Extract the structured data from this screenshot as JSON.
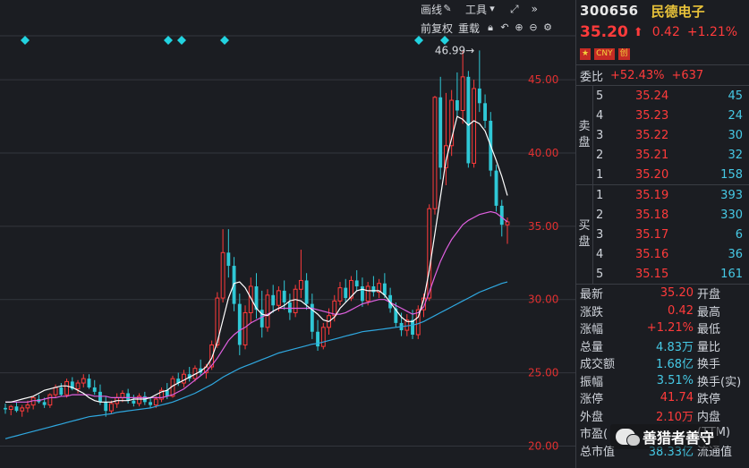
{
  "toolbar": {
    "draw_label": "画线",
    "tools_label": "工具",
    "adjust_label": "前复权",
    "reload_label": "重载"
  },
  "stock": {
    "code": "300656",
    "name": "民德电子",
    "price": "35.20",
    "change": "0.42",
    "change_pct": "+1.21%",
    "badges": [
      "CNY",
      "创"
    ]
  },
  "weibi": {
    "label": "委比",
    "pct": "+52.43%",
    "diff": "+637"
  },
  "ask": {
    "label": "卖盘",
    "rows": [
      {
        "level": "5",
        "price": "35.24",
        "vol": "45"
      },
      {
        "level": "4",
        "price": "35.23",
        "vol": "24"
      },
      {
        "level": "3",
        "price": "35.22",
        "vol": "30"
      },
      {
        "level": "2",
        "price": "35.21",
        "vol": "32"
      },
      {
        "level": "1",
        "price": "35.20",
        "vol": "158"
      }
    ]
  },
  "bid": {
    "label": "买盘",
    "rows": [
      {
        "level": "1",
        "price": "35.19",
        "vol": "393"
      },
      {
        "level": "2",
        "price": "35.18",
        "vol": "330"
      },
      {
        "level": "3",
        "price": "35.17",
        "vol": "6"
      },
      {
        "level": "4",
        "price": "35.16",
        "vol": "36"
      },
      {
        "level": "5",
        "price": "35.15",
        "vol": "161"
      }
    ]
  },
  "stats": [
    {
      "k": "最新",
      "v": "35.20",
      "k2": "开盘"
    },
    {
      "k": "涨跌",
      "v": "0.42",
      "k2": "最高"
    },
    {
      "k": "涨幅",
      "v": "+1.21%",
      "k2": "最低"
    },
    {
      "k": "总量",
      "v": "4.83万",
      "k2": "量比"
    },
    {
      "k": "成交额",
      "v": "1.68亿",
      "k2": "换手"
    },
    {
      "k": "振幅",
      "v": "3.51%",
      "k2": "换手(实)"
    },
    {
      "k": "涨停",
      "v": "41.74",
      "k2": "跌停"
    },
    {
      "k": "外盘",
      "v": "2.10万",
      "k2": "内盘"
    },
    {
      "k": "市盈(",
      "v": "",
      "k2": "(TTM)"
    },
    {
      "k": "总市值",
      "v": "38.33亿",
      "k2": "流通值"
    }
  ],
  "colors": {
    "up": "#ff3b3b",
    "down": "#2fc8d6",
    "ma5": "#ffffff",
    "ma10": "#e060e0",
    "ma20": "#2fa8e0",
    "grid": "#33363d",
    "axis_text": "#e03030"
  },
  "watermark": "善猎者善守",
  "chart_data": {
    "type": "candlestick",
    "ylim": [
      18.5,
      48
    ],
    "y_ticks": [
      20.0,
      25.0,
      30.0,
      35.0,
      40.0,
      45.0
    ],
    "y_tick_labels": [
      "20.00",
      "25.00",
      "30.00",
      "35.00",
      "40.00",
      "45.00"
    ],
    "max_label": "46.99→",
    "grid": true,
    "candles": [
      [
        22.6,
        22.9,
        22.2,
        22.5
      ],
      [
        22.5,
        22.8,
        22.1,
        22.7
      ],
      [
        22.7,
        23.0,
        22.3,
        22.4
      ],
      [
        22.4,
        22.8,
        22.0,
        22.6
      ],
      [
        22.6,
        23.1,
        22.3,
        22.8
      ],
      [
        22.8,
        23.4,
        22.5,
        23.3
      ],
      [
        23.2,
        23.5,
        22.9,
        23.0
      ],
      [
        23.0,
        23.3,
        22.6,
        22.8
      ],
      [
        22.8,
        23.6,
        22.6,
        23.5
      ],
      [
        23.5,
        24.2,
        23.3,
        24.0
      ],
      [
        24.0,
        24.3,
        23.4,
        23.5
      ],
      [
        23.5,
        24.6,
        23.3,
        24.4
      ],
      [
        24.4,
        24.7,
        23.8,
        23.9
      ],
      [
        23.9,
        24.5,
        23.6,
        24.3
      ],
      [
        24.3,
        24.9,
        24.0,
        24.6
      ],
      [
        24.6,
        24.9,
        23.9,
        24.0
      ],
      [
        24.0,
        24.5,
        23.5,
        23.7
      ],
      [
        23.7,
        24.2,
        22.8,
        23.0
      ],
      [
        23.0,
        23.4,
        22.0,
        22.4
      ],
      [
        22.4,
        23.1,
        22.2,
        22.9
      ],
      [
        22.9,
        23.6,
        22.6,
        23.3
      ],
      [
        23.3,
        23.8,
        23.0,
        23.6
      ],
      [
        23.6,
        23.9,
        22.9,
        23.1
      ],
      [
        23.1,
        23.5,
        22.7,
        22.9
      ],
      [
        22.9,
        23.6,
        22.7,
        23.4
      ],
      [
        23.4,
        23.7,
        22.8,
        23.0
      ],
      [
        23.0,
        23.3,
        22.6,
        22.8
      ],
      [
        22.8,
        23.4,
        22.6,
        23.2
      ],
      [
        23.2,
        24.0,
        23.0,
        23.8
      ],
      [
        23.8,
        24.3,
        23.2,
        23.4
      ],
      [
        23.4,
        24.8,
        23.3,
        24.6
      ],
      [
        24.6,
        25.0,
        24.1,
        24.3
      ],
      [
        24.3,
        25.2,
        24.0,
        24.9
      ],
      [
        24.9,
        25.4,
        24.4,
        24.6
      ],
      [
        24.6,
        25.5,
        24.4,
        25.3
      ],
      [
        25.3,
        25.9,
        24.8,
        25.0
      ],
      [
        25.0,
        25.6,
        24.6,
        25.4
      ],
      [
        25.4,
        27.2,
        25.2,
        26.9
      ],
      [
        26.9,
        30.5,
        26.7,
        30.1
      ],
      [
        30.1,
        34.8,
        29.8,
        33.2
      ],
      [
        33.2,
        34.8,
        31.5,
        32.3
      ],
      [
        32.3,
        32.9,
        29.2,
        29.7
      ],
      [
        29.7,
        30.4,
        26.2,
        26.9
      ],
      [
        26.9,
        29.6,
        26.6,
        29.1
      ],
      [
        29.1,
        31.5,
        28.4,
        30.9
      ],
      [
        30.9,
        31.8,
        28.7,
        29.3
      ],
      [
        29.3,
        30.6,
        27.4,
        28.1
      ],
      [
        28.1,
        30.7,
        27.8,
        30.3
      ],
      [
        30.3,
        31.0,
        29.1,
        29.6
      ],
      [
        29.6,
        30.9,
        29.2,
        30.6
      ],
      [
        30.6,
        31.3,
        29.3,
        29.8
      ],
      [
        29.8,
        30.4,
        28.6,
        29.1
      ],
      [
        29.1,
        31.0,
        28.8,
        30.7
      ],
      [
        30.7,
        33.4,
        30.1,
        31.3
      ],
      [
        31.3,
        31.8,
        29.3,
        29.7
      ],
      [
        29.7,
        30.4,
        27.3,
        27.8
      ],
      [
        27.8,
        28.6,
        26.5,
        26.8
      ],
      [
        26.8,
        28.4,
        26.6,
        28.1
      ],
      [
        28.1,
        29.4,
        27.6,
        28.9
      ],
      [
        28.9,
        30.3,
        28.5,
        29.9
      ],
      [
        29.9,
        31.2,
        29.6,
        30.8
      ],
      [
        30.8,
        31.4,
        29.8,
        30.1
      ],
      [
        30.1,
        31.6,
        29.9,
        31.3
      ],
      [
        31.3,
        32.0,
        30.6,
        30.9
      ],
      [
        30.9,
        31.5,
        29.5,
        29.9
      ],
      [
        29.9,
        31.2,
        29.6,
        30.9
      ],
      [
        30.9,
        31.6,
        30.2,
        30.5
      ],
      [
        30.5,
        31.4,
        30.1,
        31.1
      ],
      [
        31.1,
        31.8,
        30.1,
        30.3
      ],
      [
        30.3,
        30.8,
        29.1,
        29.4
      ],
      [
        29.4,
        29.8,
        28.1,
        28.4
      ],
      [
        28.4,
        29.1,
        27.5,
        27.9
      ],
      [
        27.9,
        29.0,
        27.5,
        28.6
      ],
      [
        28.6,
        29.3,
        27.3,
        27.6
      ],
      [
        27.6,
        29.6,
        27.3,
        29.3
      ],
      [
        29.3,
        30.4,
        28.8,
        30.1
      ],
      [
        30.1,
        36.5,
        29.9,
        36.2
      ],
      [
        36.2,
        43.9,
        35.8,
        43.8
      ],
      [
        43.8,
        45.2,
        38.2,
        39.0
      ],
      [
        39.0,
        44.1,
        37.8,
        40.5
      ],
      [
        40.5,
        44.3,
        39.8,
        43.6
      ],
      [
        43.6,
        45.5,
        42.5,
        42.9
      ],
      [
        42.9,
        46.99,
        42.0,
        45.2
      ],
      [
        45.2,
        45.6,
        39.0,
        39.3
      ],
      [
        39.3,
        45.0,
        39.0,
        44.4
      ],
      [
        44.4,
        47.0,
        42.8,
        43.4
      ],
      [
        43.4,
        44.0,
        41.7,
        42.2
      ],
      [
        42.2,
        42.8,
        38.4,
        38.8
      ],
      [
        38.8,
        39.2,
        36.0,
        36.4
      ],
      [
        36.4,
        36.8,
        34.3,
        35.1
      ],
      [
        35.1,
        35.6,
        33.8,
        35.3
      ]
    ],
    "ma5": [
      23.0,
      23.0,
      23.1,
      23.2,
      23.3,
      23.4,
      23.6,
      23.8,
      23.9,
      24.0,
      24.1,
      24.1,
      24.0,
      23.8,
      23.6,
      23.3,
      23.1,
      23.0,
      23.0,
      23.0,
      23.1,
      23.1,
      23.1,
      23.2,
      23.2,
      23.2,
      23.3,
      23.5,
      23.7,
      23.8,
      24.1,
      24.3,
      24.5,
      24.7,
      24.9,
      25.1,
      25.4,
      26.0,
      27.1,
      28.6,
      30.1,
      31.1,
      31.2,
      30.8,
      30.1,
      29.4,
      29.0,
      28.9,
      29.2,
      29.4,
      29.6,
      29.9,
      30.0,
      29.9,
      29.6,
      29.3,
      29.0,
      28.6,
      28.5,
      28.8,
      29.4,
      29.8,
      30.2,
      30.6,
      30.7,
      30.6,
      30.6,
      30.6,
      30.3,
      29.8,
      29.3,
      28.8,
      28.5,
      28.5,
      28.8,
      30.0,
      32.0,
      34.5,
      37.0,
      39.5,
      41.0,
      42.5,
      42.3,
      41.9,
      42.2,
      42.0,
      41.5,
      40.5,
      39.5,
      38.4,
      37.1
    ],
    "ma10": [
      23.0,
      23.0,
      23.0,
      23.0,
      23.0,
      23.1,
      23.1,
      23.2,
      23.3,
      23.3,
      23.4,
      23.4,
      23.5,
      23.5,
      23.5,
      23.5,
      23.4,
      23.4,
      23.4,
      23.3,
      23.3,
      23.3,
      23.3,
      23.3,
      23.3,
      23.3,
      23.3,
      23.3,
      23.3,
      23.4,
      23.5,
      23.7,
      23.9,
      24.2,
      24.5,
      24.8,
      25.1,
      25.5,
      26.0,
      26.6,
      27.2,
      27.6,
      27.9,
      28.1,
      28.4,
      28.6,
      28.8,
      29.0,
      29.2,
      29.4,
      29.4,
      29.4,
      29.4,
      29.4,
      29.4,
      29.4,
      29.3,
      29.2,
      29.1,
      29.0,
      29.0,
      29.1,
      29.3,
      29.5,
      29.7,
      29.8,
      29.9,
      30.0,
      30.0,
      29.8,
      29.6,
      29.4,
      29.2,
      29.0,
      29.1,
      29.5,
      30.5,
      31.6,
      32.6,
      33.4,
      34.1,
      34.6,
      35.1,
      35.4,
      35.6,
      35.8,
      35.9,
      36.0,
      35.9,
      35.6,
      35.3
    ],
    "ma20": [
      20.5,
      20.6,
      20.7,
      20.8,
      20.9,
      21.0,
      21.1,
      21.2,
      21.3,
      21.4,
      21.5,
      21.6,
      21.7,
      21.8,
      21.9,
      22.0,
      22.05,
      22.1,
      22.15,
      22.2,
      22.3,
      22.35,
      22.4,
      22.45,
      22.5,
      22.55,
      22.6,
      22.7,
      22.8,
      22.9,
      23.0,
      23.15,
      23.3,
      23.45,
      23.6,
      23.8,
      24.0,
      24.2,
      24.45,
      24.7,
      24.9,
      25.1,
      25.3,
      25.45,
      25.6,
      25.75,
      25.9,
      26.05,
      26.2,
      26.35,
      26.45,
      26.55,
      26.65,
      26.75,
      26.85,
      26.95,
      27.0,
      27.1,
      27.2,
      27.3,
      27.4,
      27.5,
      27.6,
      27.7,
      27.8,
      27.85,
      27.9,
      27.95,
      28.0,
      28.05,
      28.1,
      28.15,
      28.2,
      28.25,
      28.35,
      28.5,
      28.7,
      28.9,
      29.1,
      29.3,
      29.5,
      29.7,
      29.9,
      30.1,
      30.3,
      30.5,
      30.65,
      30.8,
      30.95,
      31.1,
      31.2
    ]
  }
}
